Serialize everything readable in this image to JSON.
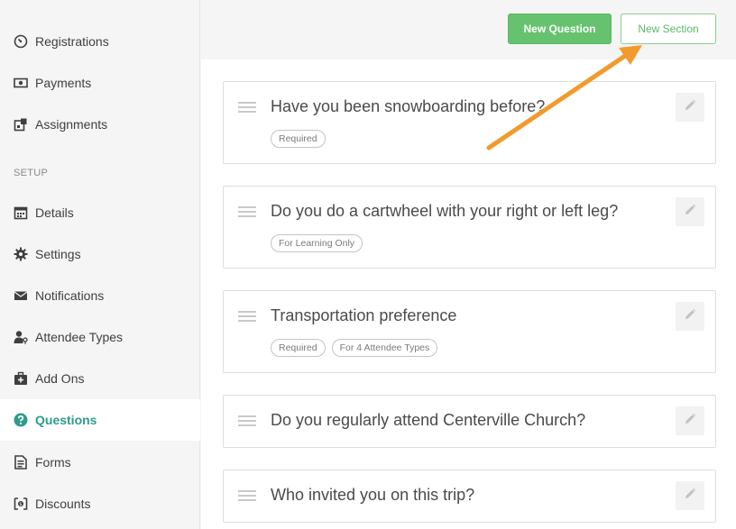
{
  "sidebar": {
    "items_top": [
      {
        "label": "Registrations",
        "icon": "speedometer-icon"
      },
      {
        "label": "Payments",
        "icon": "money-icon"
      },
      {
        "label": "Assignments",
        "icon": "assignments-icon"
      }
    ],
    "setup_label": "SETUP",
    "items_setup": [
      {
        "label": "Details",
        "icon": "calendar-icon"
      },
      {
        "label": "Settings",
        "icon": "gear-icon"
      },
      {
        "label": "Notifications",
        "icon": "envelope-icon"
      },
      {
        "label": "Attendee Types",
        "icon": "user-key-icon"
      },
      {
        "label": "Add Ons",
        "icon": "medkit-icon"
      },
      {
        "label": "Questions",
        "icon": "question-circle-icon",
        "active": true
      },
      {
        "label": "Forms",
        "icon": "document-icon"
      },
      {
        "label": "Discounts",
        "icon": "discount-icon"
      }
    ]
  },
  "toolbar": {
    "new_question_label": "New Question",
    "new_section_label": "New Section"
  },
  "questions": [
    {
      "title": "Have you been snowboarding before?",
      "tags": [
        "Required"
      ]
    },
    {
      "title": "Do you do a cartwheel with your right or left leg?",
      "tags": [
        "For Learning Only"
      ]
    },
    {
      "title": "Transportation preference",
      "tags": [
        "Required",
        "For 4 Attendee Types"
      ]
    },
    {
      "title": "Do you regularly attend Centerville Church?",
      "tags": []
    },
    {
      "title": "Who invited you on this trip?",
      "tags": []
    }
  ],
  "colors": {
    "accent": "#2d9c8a",
    "primary_button": "#66c26e",
    "annotation_arrow": "#f39a2d"
  }
}
